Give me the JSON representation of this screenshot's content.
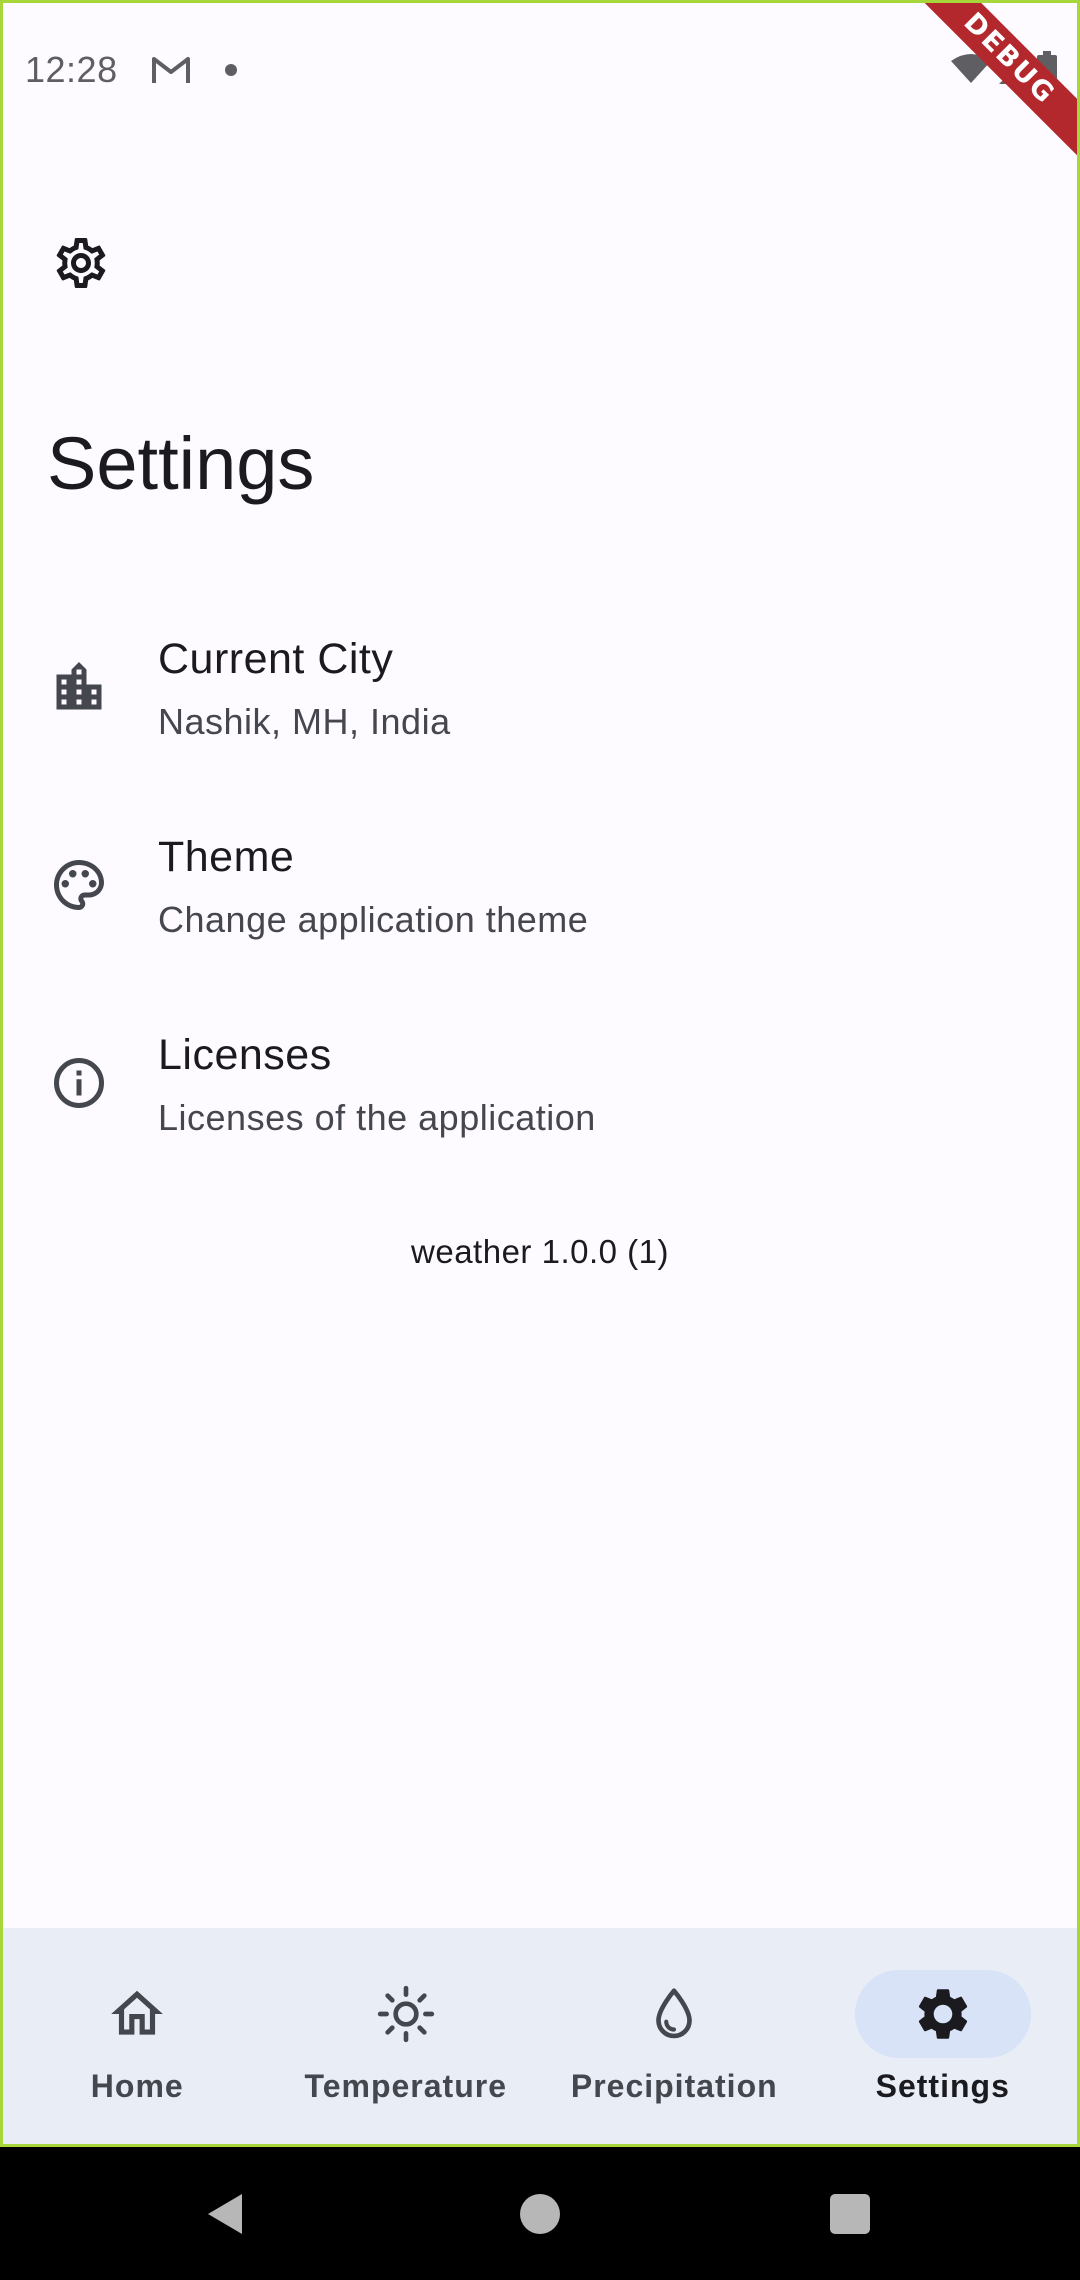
{
  "status_bar": {
    "time": "12:28",
    "notification_icons": [
      "gmail-icon",
      "dot-icon"
    ],
    "system_icons": [
      "wifi-icon",
      "signal-icon",
      "battery-icon"
    ]
  },
  "debug_banner": "DEBUG",
  "app_bar": {
    "icon": "gear-icon"
  },
  "page": {
    "title": "Settings"
  },
  "settings": {
    "items": [
      {
        "icon": "city-icon",
        "title": "Current City",
        "subtitle": "Nashik, MH, India"
      },
      {
        "icon": "palette-icon",
        "title": "Theme",
        "subtitle": "Change application theme"
      },
      {
        "icon": "info-icon",
        "title": "Licenses",
        "subtitle": "Licenses of the application"
      }
    ]
  },
  "version": "weather 1.0.0 (1)",
  "bottom_nav": {
    "items": [
      {
        "icon": "home-icon",
        "label": "Home",
        "active": false
      },
      {
        "icon": "sun-icon",
        "label": "Temperature",
        "active": false
      },
      {
        "icon": "drop-icon",
        "label": "Precipitation",
        "active": false
      },
      {
        "icon": "gear-icon",
        "label": "Settings",
        "active": true
      }
    ]
  },
  "colors": {
    "background": "#fdfbff",
    "nav_background": "#e9edf6",
    "nav_indicator": "#d8e3f8",
    "debug_banner": "#b3282d",
    "frame_border": "#a6d63a"
  }
}
